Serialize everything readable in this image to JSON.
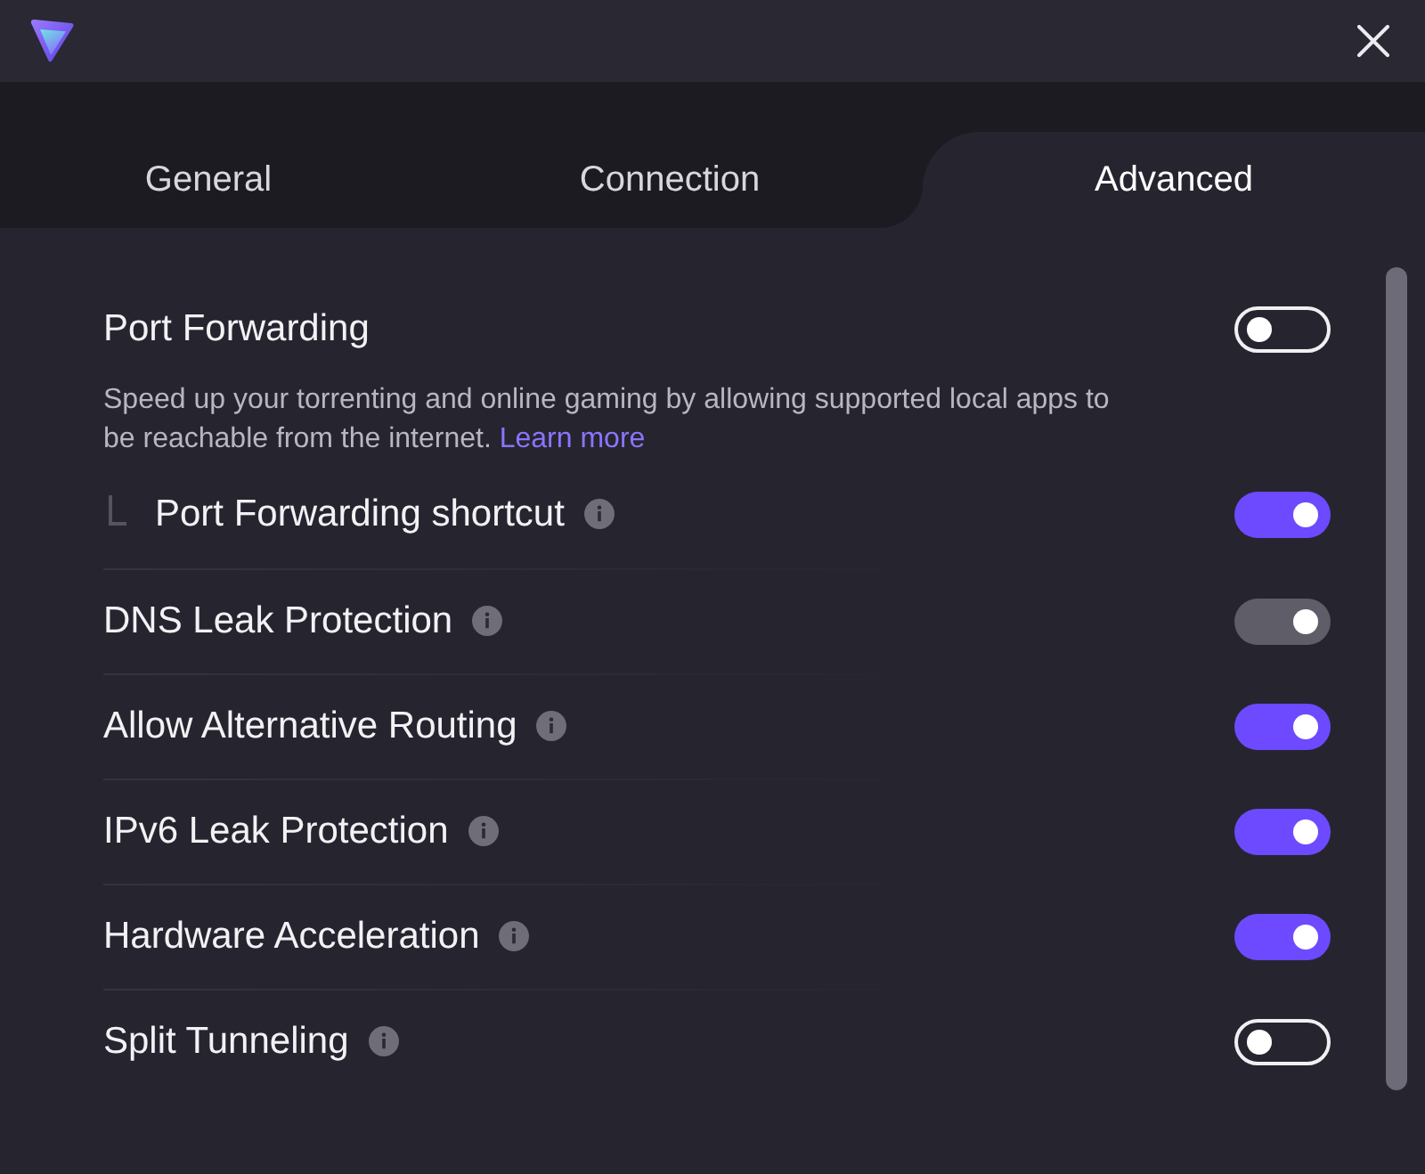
{
  "tabs": [
    {
      "label": "General",
      "selected": false
    },
    {
      "label": "Connection",
      "selected": false
    },
    {
      "label": "Advanced",
      "selected": true
    }
  ],
  "settings": [
    {
      "label": "Port Forwarding",
      "info": false,
      "on": false,
      "disabled": false,
      "description": {
        "text": "Speed up your torrenting and online gaming by allowing supported local apps to be reachable from the internet.",
        "link": "Learn more"
      },
      "children": [
        {
          "label": "Port Forwarding shortcut",
          "info": true,
          "on": true,
          "disabled": false
        }
      ]
    },
    {
      "label": "DNS Leak Protection",
      "info": true,
      "on": true,
      "disabled": true
    },
    {
      "label": "Allow Alternative Routing",
      "info": true,
      "on": true,
      "disabled": false
    },
    {
      "label": "IPv6 Leak Protection",
      "info": true,
      "on": true,
      "disabled": false
    },
    {
      "label": "Hardware Acceleration",
      "info": true,
      "on": true,
      "disabled": false
    },
    {
      "label": "Split Tunneling",
      "info": true,
      "on": false,
      "disabled": false
    }
  ]
}
